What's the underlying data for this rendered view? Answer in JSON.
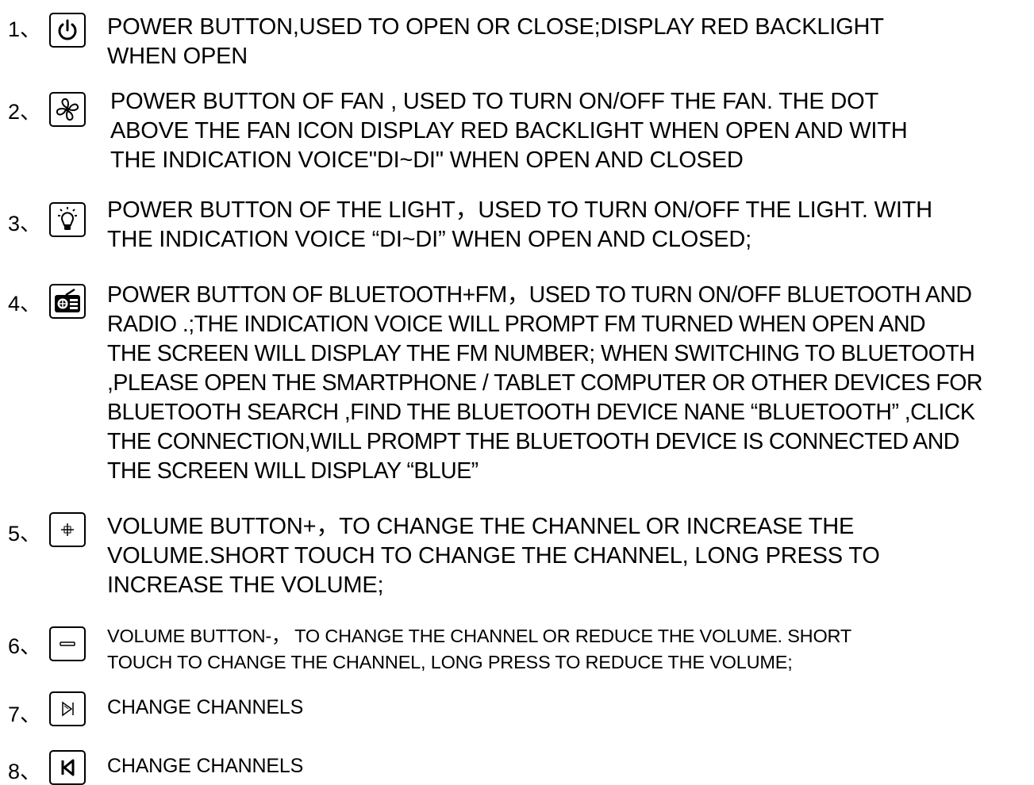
{
  "items": [
    {
      "number": "1、",
      "icon": "power-icon",
      "text": "POWER BUTTON,USED TO OPEN OR CLOSE;DISPLAY RED BACKLIGHT\nWHEN OPEN"
    },
    {
      "number": "2、",
      "icon": "fan-icon",
      "text": "POWER BUTTON OF FAN , USED TO TURN ON/OFF THE FAN. THE DOT\nABOVE THE FAN ICON DISPLAY RED BACKLIGHT WHEN OPEN AND WITH\nTHE INDICATION VOICE\"DI~DI\" WHEN OPEN AND CLOSED"
    },
    {
      "number": "3、",
      "icon": "light-bulb-icon",
      "text": "POWER BUTTON OF THE LIGHT，USED TO TURN ON/OFF THE LIGHT. WITH\nTHE INDICATION VOICE “DI~DI”  WHEN OPEN AND CLOSED;"
    },
    {
      "number": "4、",
      "icon": "radio-icon",
      "text": "POWER BUTTON OF BLUETOOTH+FM，USED TO TURN ON/OFF BLUETOOTH AND\nRADIO .;THE INDICATION VOICE WILL PROMPT FM TURNED WHEN OPEN AND\nTHE SCREEN WILL DISPLAY THE FM NUMBER; WHEN SWITCHING TO BLUETOOTH\n,PLEASE OPEN THE SMARTPHONE / TABLET COMPUTER OR OTHER DEVICES FOR\nBLUETOOTH SEARCH ,FIND THE BLUETOOTH DEVICE NANE  “BLUETOOTH” ,CLICK\nTHE CONNECTION,WILL PROMPT THE BLUETOOTH DEVICE IS CONNECTED AND\nTHE SCREEN WILL DISPLAY  “BLUE”"
    },
    {
      "number": "5、",
      "icon": "plus-icon",
      "text": "VOLUME BUTTON+，TO CHANGE THE CHANNEL OR INCREASE THE\nVOLUME.SHORT TOUCH TO CHANGE THE CHANNEL, LONG PRESS TO\nINCREASE THE VOLUME;"
    },
    {
      "number": "6、",
      "icon": "minus-icon",
      "text": "VOLUME BUTTON-，  TO CHANGE THE CHANNEL OR REDUCE THE VOLUME. SHORT\nTOUCH TO CHANGE THE CHANNEL, LONG PRESS TO REDUCE THE VOLUME;"
    },
    {
      "number": "7、",
      "icon": "next-channel-icon",
      "text": "CHANGE CHANNELS"
    },
    {
      "number": "8、",
      "icon": "previous-channel-icon",
      "text": "CHANGE CHANNELS"
    }
  ]
}
